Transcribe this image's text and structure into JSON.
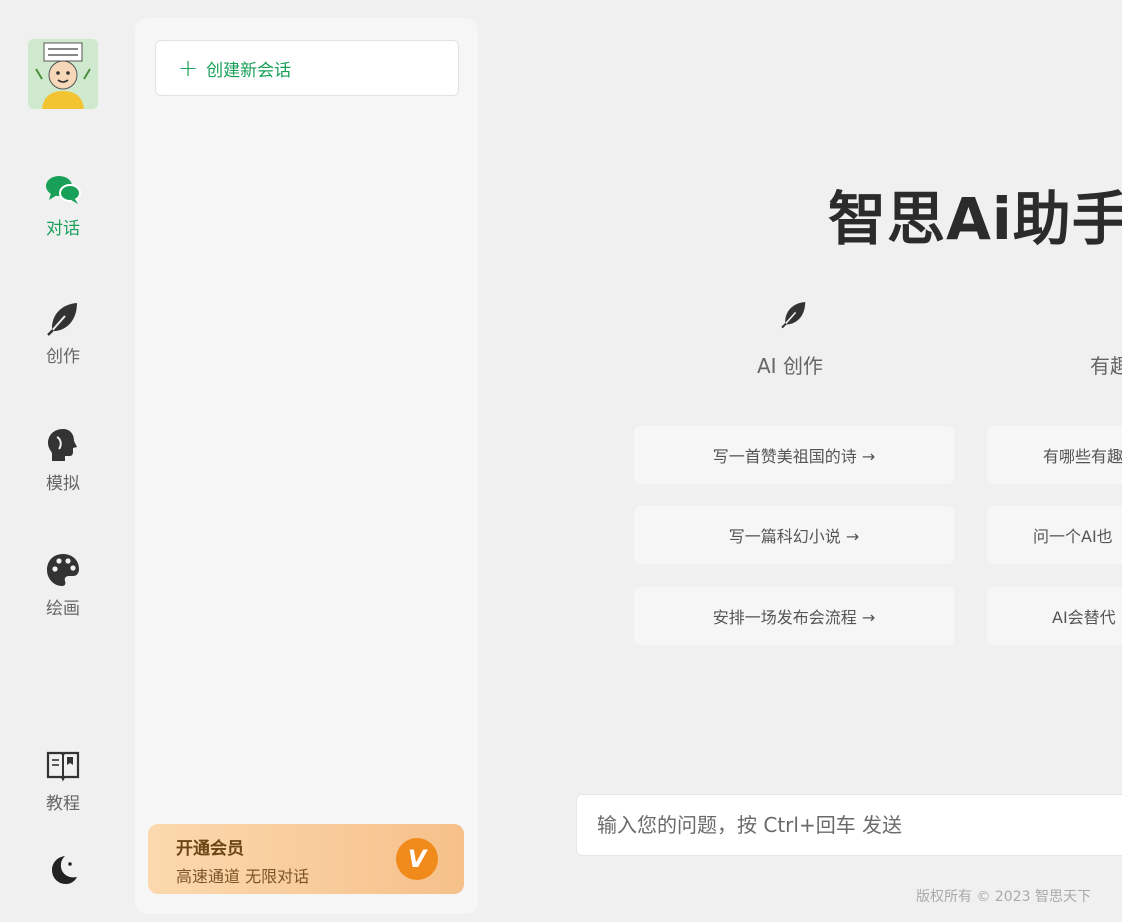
{
  "nav": {
    "items": [
      {
        "label": "对话",
        "icon": "chat-bubbles-icon",
        "active": true
      },
      {
        "label": "创作",
        "icon": "feather-icon",
        "active": false
      },
      {
        "label": "模拟",
        "icon": "head-profile-icon",
        "active": false
      },
      {
        "label": "绘画",
        "icon": "palette-icon",
        "active": false
      },
      {
        "label": "教程",
        "icon": "open-book-icon",
        "active": false
      }
    ],
    "theme_icon": "moon-icon"
  },
  "panel": {
    "new_chat_label": "创建新会话",
    "vip": {
      "title": "开通会员",
      "subtitle": "高速通道 无限对话",
      "badge": "V"
    }
  },
  "main": {
    "title": "智思Ai助手",
    "categories": [
      {
        "label": "AI 创作",
        "icon": "feather-icon"
      },
      {
        "label": "有趣"
      }
    ],
    "prompts_col1": [
      "写一首赞美祖国的诗 →",
      "写一篇科幻小说 →",
      "安排一场发布会流程 →"
    ],
    "prompts_col2": [
      "有哪些有趣",
      "问一个AI也",
      "AI会替代"
    ],
    "input_placeholder": "输入您的问题，按 Ctrl+回车 发送",
    "footer": "版权所有 © 2023 智思天下"
  },
  "colors": {
    "accent": "#18a058",
    "vip_badge": "#f08a1a",
    "background": "#f0f0f0"
  }
}
